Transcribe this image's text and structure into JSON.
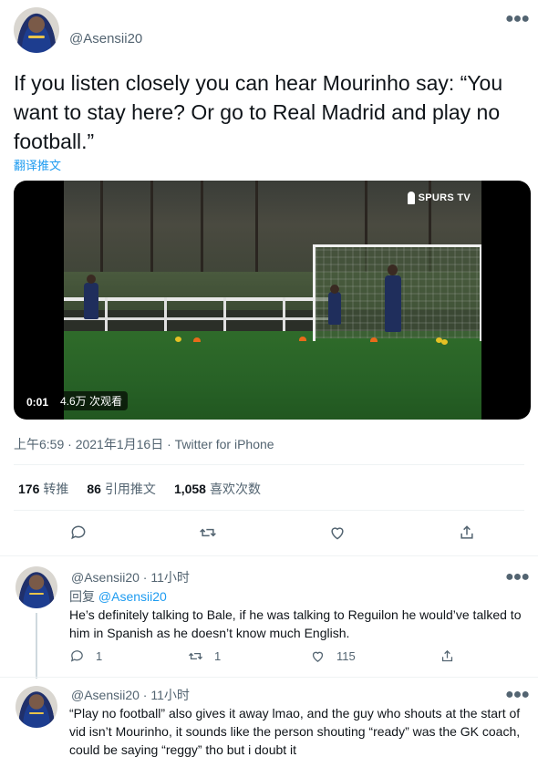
{
  "tweet": {
    "handle": "@Asensii20",
    "text": "If you listen closely you can hear Mourinho say: “You want to stay here? Or go to Real Madrid and play no football.”",
    "translate_label": "翻译推文",
    "video": {
      "watermark": "SPURS TV",
      "time": "0:01",
      "views": "4.6万 次观看"
    },
    "meta": "上午6:59 · 2021年1月16日 · Twitter for iPhone",
    "stats": [
      {
        "num": "176",
        "label": "转推"
      },
      {
        "num": "86",
        "label": "引用推文"
      },
      {
        "num": "1,058",
        "label": "喜欢次数"
      }
    ],
    "actions": [
      "reply-icon",
      "retweet-icon",
      "like-icon",
      "share-icon"
    ]
  },
  "replies": [
    {
      "handle": "@Asensii20",
      "time": "11小时",
      "reply_prefix": "回复",
      "reply_to": "@Asensii20",
      "text": "He’s definitely talking to Bale, if he was talking to Reguilon he would’ve talked to him in Spanish as he doesn’t know much English.",
      "counts": {
        "reply": "1",
        "retweet": "1",
        "like": "115"
      }
    },
    {
      "handle": "@Asensii20",
      "time": "11小时",
      "text": "“Play no football” also gives it away lmao, and the guy who shouts at the start of vid isn’t Mourinho, it sounds like the person shouting “ready” was the GK coach, could be saying “reggy” tho but i doubt it"
    }
  ],
  "colors": {
    "accent": "#1d9bf0",
    "secondary_text": "#536471",
    "primary_text": "#0f1419"
  }
}
